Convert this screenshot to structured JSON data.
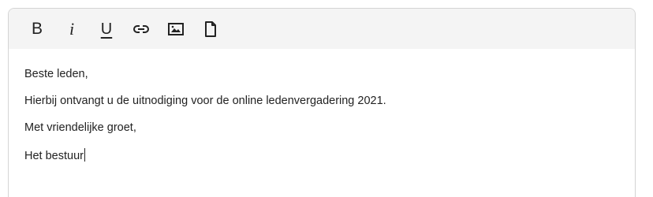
{
  "toolbar": {
    "bold_label": "B",
    "italic_label": "i",
    "underline_label": "U",
    "buttons": [
      "bold",
      "italic",
      "underline",
      "link-icon",
      "image-icon",
      "file-icon"
    ]
  },
  "content": {
    "lines": [
      "Beste leden,",
      "Hierbij ontvangt u de uitnodiging voor de online ledenvergadering 2021.",
      "Met vriendelijke groet,",
      "Het bestuur"
    ]
  },
  "colors": {
    "toolbar_bg": "#f4f4f4",
    "border": "#d4d4d4",
    "text": "#222222"
  }
}
